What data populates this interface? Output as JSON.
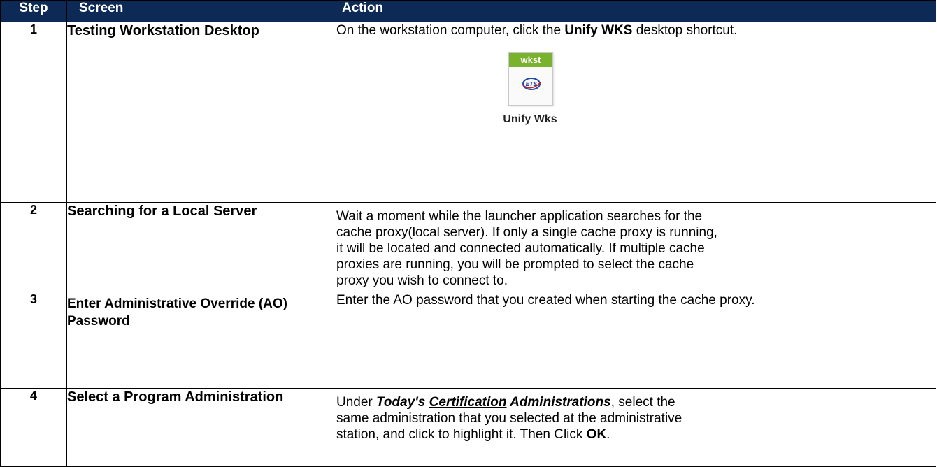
{
  "headers": {
    "step": "Step",
    "screen": "Screen",
    "action": "Action"
  },
  "rows": [
    {
      "step": "1",
      "screen": "Testing Workstation Desktop",
      "action": {
        "pre": "On the workstation computer, click the ",
        "bold": "Unify WKS",
        "post": " desktop shortcut."
      },
      "shortcut": {
        "tile_label": "wkst",
        "logo_text": "ETS",
        "caption": "Unify Wks",
        "accent": "#79b32d"
      }
    },
    {
      "step": "2",
      "screen": "Searching for a Local Server",
      "action": {
        "line1": "Wait a moment while the launcher application searches for the",
        "line2": "cache proxy(local server). If only a single cache proxy is running,",
        "line3": "it will be located and connected automatically. If multiple cache",
        "line4": "proxies are running, you will be prompted to select the cache",
        "line5": "proxy you wish to connect to."
      }
    },
    {
      "step": "3",
      "screen": "Enter Administrative Override (AO) Password",
      "action": {
        "text": "Enter the AO password that you created when starting the cache proxy."
      }
    },
    {
      "step": "4",
      "screen": "Select a Program Administration",
      "action": {
        "under": "Under ",
        "italic1": "Today's ",
        "italic_underlined": "Certification",
        "italic2": " Administrations",
        "rest1": ", select the",
        "line2": "same administration that you selected at the administrative",
        "line3_pre": "station, and click to highlight it. Then Click ",
        "ok": "OK",
        "period": "."
      }
    }
  ],
  "colors": {
    "header_bg": "#0c2a55",
    "header_text": "#ffffff"
  }
}
